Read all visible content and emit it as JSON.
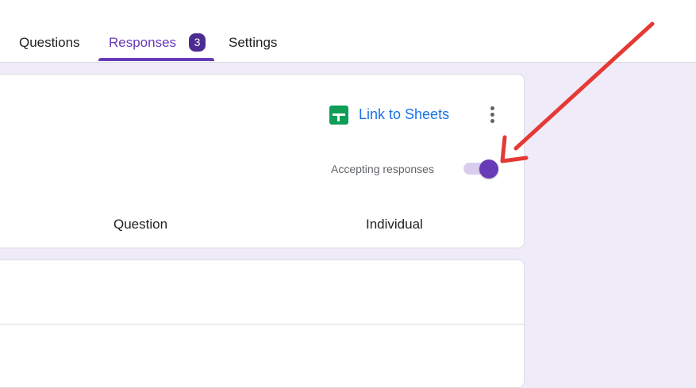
{
  "tabs": {
    "questions": "Questions",
    "responses": "Responses",
    "responses_count": "3",
    "settings": "Settings"
  },
  "responses_card": {
    "link_to_sheets": "Link to Sheets",
    "accepting_label": "Accepting responses",
    "accepting_on": true,
    "subtabs": {
      "question": "Question",
      "individual": "Individual"
    }
  },
  "icons": {
    "sheets": "sheets-icon",
    "more": "more-vert-icon"
  },
  "colors": {
    "accent": "#673ab7",
    "badge": "#4d2c91",
    "link": "#1a73e8",
    "sheets_green": "#0f9d58",
    "annotation_arrow": "#e53935",
    "page_bg": "#f0ebf8"
  }
}
